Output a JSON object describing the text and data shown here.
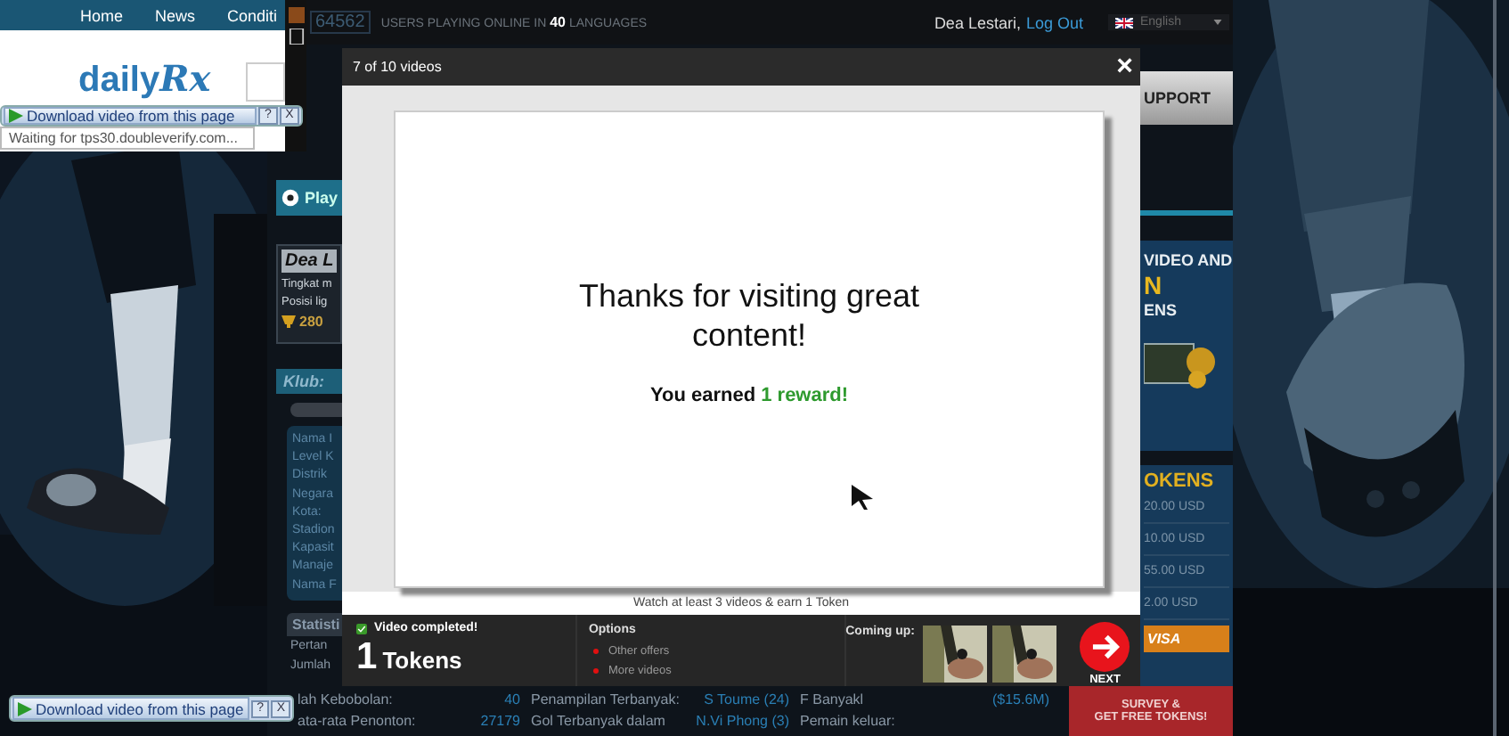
{
  "popup_window": {
    "nav": [
      "Home",
      "News",
      "Conditi"
    ],
    "logo": {
      "text": "daily",
      "accent": "Rx"
    },
    "download_bar": {
      "label": "Download video from this page",
      "help": "?",
      "close": "X"
    },
    "status": "Waiting for tps30.doubleverify.com..."
  },
  "site": {
    "online_count": "64562",
    "online_text": "USERS PLAYING ONLINE IN **40** LANGUAGES",
    "user": "Dea Lestari,",
    "logout": "Log Out",
    "language": "English",
    "left": {
      "tab": "Play",
      "profile_name": "Dea L",
      "profile_rows": [
        "Tingkat m",
        "Posisi lig"
      ],
      "trophy_value": "280",
      "club_header": "Klub:",
      "club_rows": [
        "Nama I",
        "Level K",
        "Distrik",
        "Negara",
        "Kota:",
        "Stadion",
        "Kapasit",
        "Manaje",
        "Nama F"
      ],
      "stats_tab": "Statisti",
      "stats_rows": [
        "Pertan",
        "Jumlah"
      ]
    },
    "right": {
      "support": "UPPORT",
      "promo_lines": [
        {
          "text": "VIDEO AND",
          "kind": "plain"
        },
        {
          "text": "N",
          "kind": "accent"
        },
        {
          "text": "ENS",
          "kind": "plain"
        }
      ],
      "tokens_title": "OKENS",
      "prices": [
        "20.00 USD",
        "10.00 USD",
        "55.00 USD",
        "2.00 USD"
      ],
      "cards": "VISA",
      "survey": [
        "SURVEY &",
        "GET FREE TOKENS!"
      ]
    },
    "stats": [
      [
        {
          "label": "lah Kebobolan:",
          "value": "40"
        },
        {
          "label": "ata-rata Penonton:",
          "value": "27179"
        }
      ],
      [
        {
          "label": "Penampilan Terbanyak:",
          "value": "S Toume (24)"
        },
        {
          "label": "Gol Terbanyak dalam",
          "value": "N.Vi Phong (3)"
        }
      ],
      [
        {
          "label": "F Banyakl",
          "value": "($15.6M)"
        },
        {
          "label": "Pemain keluar:"
        }
      ]
    ]
  },
  "modal": {
    "title": "7 of 10 videos",
    "close": "×",
    "message": "Thanks for visiting great content!",
    "earned_prefix": "You earned",
    "earned_reward": "1 reward!",
    "footer": "Watch at least 3 videos & earn 1 Token",
    "status": "Video completed!",
    "token_count": "1",
    "token_unit": "Tokens",
    "options_title": "Options",
    "options": [
      "Other offers",
      "More videos"
    ],
    "coming_up": "Coming up:",
    "next": "NEXT"
  },
  "download_bar": {
    "label": "Download video from this page",
    "help": "?",
    "close": "X"
  }
}
